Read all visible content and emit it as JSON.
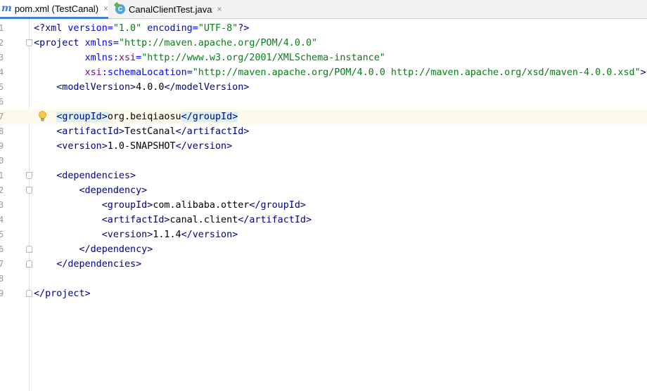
{
  "tabs": [
    {
      "icon": "maven-icon",
      "glyph": "m",
      "label": "pom.xml (TestCanal)",
      "close": "×",
      "active": true
    },
    {
      "icon": "java-class-icon",
      "glyph": "C",
      "label": "CanalClientTest.java",
      "close": "×",
      "active": false
    }
  ],
  "colors": {
    "tag": "#000080",
    "attr_name": "#0000ff",
    "attr_value": "#067d17",
    "namespace": "#660e7a",
    "current_line": "#fcfaed",
    "tag_match_highlight": "#d9f0f2",
    "tab_underline": "#4083c9"
  },
  "editor": {
    "line_numbers": [
      "1",
      "2",
      "3",
      "4",
      "5",
      "6",
      "7",
      "8",
      "9",
      "0",
      "1",
      "2",
      "3",
      "4",
      "5",
      "6",
      "7",
      "8",
      "9"
    ],
    "l1": {
      "lt": "<?",
      "name": "xml",
      "a1": "version",
      "eq1": "=",
      "v1": "\"1.0\"",
      "a2": "encoding",
      "eq2": "=",
      "v2": "\"UTF-8\"",
      "end": "?>"
    },
    "l2": {
      "lt": "<",
      "name": "project",
      "a1": "xmlns",
      "eq1": "=",
      "v1": "\"http://maven.apache.org/POM/4.0.0\""
    },
    "l3": {
      "ns": "xmlns",
      "colon": ":",
      "a": "xsi",
      "eq": "=",
      "v": "\"http://www.w3.org/2001/XMLSchema-instance\""
    },
    "l4": {
      "ns": "xsi",
      "colon": ":",
      "a": "schemaLocation",
      "eq": "=",
      "v": "\"http://maven.apache.org/POM/4.0.0 http://maven.apache.org/xsd/maven-4.0.0.xsd\"",
      "end": ">"
    },
    "l5": {
      "open": "<modelVersion>",
      "text": "4.0.0",
      "close": "</modelVersion>"
    },
    "l7": {
      "lt": "<",
      "name": "groupId",
      "gt": ">",
      "text": "org.beiqiaosu",
      "clt": "</",
      "cname": "groupId",
      "cgt": ">"
    },
    "l8": {
      "open": "<artifactId>",
      "text": "TestCanal",
      "close": "</artifactId>"
    },
    "l9": {
      "open": "<version>",
      "text": "1.0-SNAPSHOT",
      "close": "</version>"
    },
    "l11": {
      "open": "<dependencies>"
    },
    "l12": {
      "open": "<dependency>"
    },
    "l13": {
      "open": "<groupId>",
      "text": "com.alibaba.otter",
      "close": "</groupId>"
    },
    "l14": {
      "open": "<artifactId>",
      "text": "canal.client",
      "close": "</artifactId>"
    },
    "l15": {
      "open": "<version>",
      "text": "1.1.4",
      "close": "</version>"
    },
    "l16": {
      "close": "</dependency>"
    },
    "l17": {
      "close": "</dependencies>"
    },
    "l19": {
      "close": "</project>"
    }
  }
}
